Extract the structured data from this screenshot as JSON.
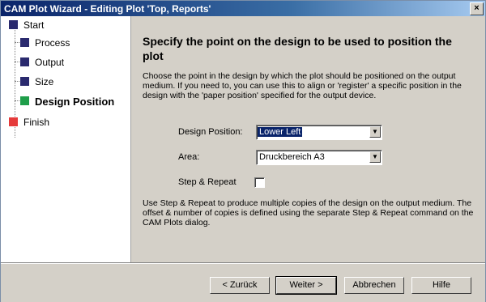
{
  "window": {
    "title": "CAM Plot Wizard - Editing Plot 'Top, Reports'",
    "close_glyph": "×"
  },
  "sidebar": {
    "steps": [
      {
        "label": "Start",
        "color": "#2a2a6e"
      },
      {
        "label": "Process",
        "color": "#2a2a6e"
      },
      {
        "label": "Output",
        "color": "#2a2a6e"
      },
      {
        "label": "Size",
        "color": "#2a2a6e"
      },
      {
        "label": "Design Position",
        "color": "#1f9e4a",
        "active": true
      },
      {
        "label": "Finish",
        "color": "#e53b3b"
      }
    ]
  },
  "main": {
    "heading": "Specify the point on the design to be used to position the plot",
    "description": "Choose the point in the design by which the plot should be positioned on the output medium. If you need to, you can use this to align or 'register' a specific position in the design with the 'paper position' specified for the output device.",
    "design_position": {
      "label": "Design Position:",
      "value": "Lower Left"
    },
    "area": {
      "label": "Area:",
      "value": "Druckbereich A3"
    },
    "step_repeat": {
      "label": "Step & Repeat",
      "checked": false
    },
    "info": "Use Step & Repeat to produce multiple copies of the design on the output medium. The offset & number of copies is defined using the separate Step & Repeat command on the CAM Plots dialog."
  },
  "buttons": {
    "back": "< Zurück",
    "next": "Weiter >",
    "cancel": "Abbrechen",
    "help": "Hilfe"
  }
}
